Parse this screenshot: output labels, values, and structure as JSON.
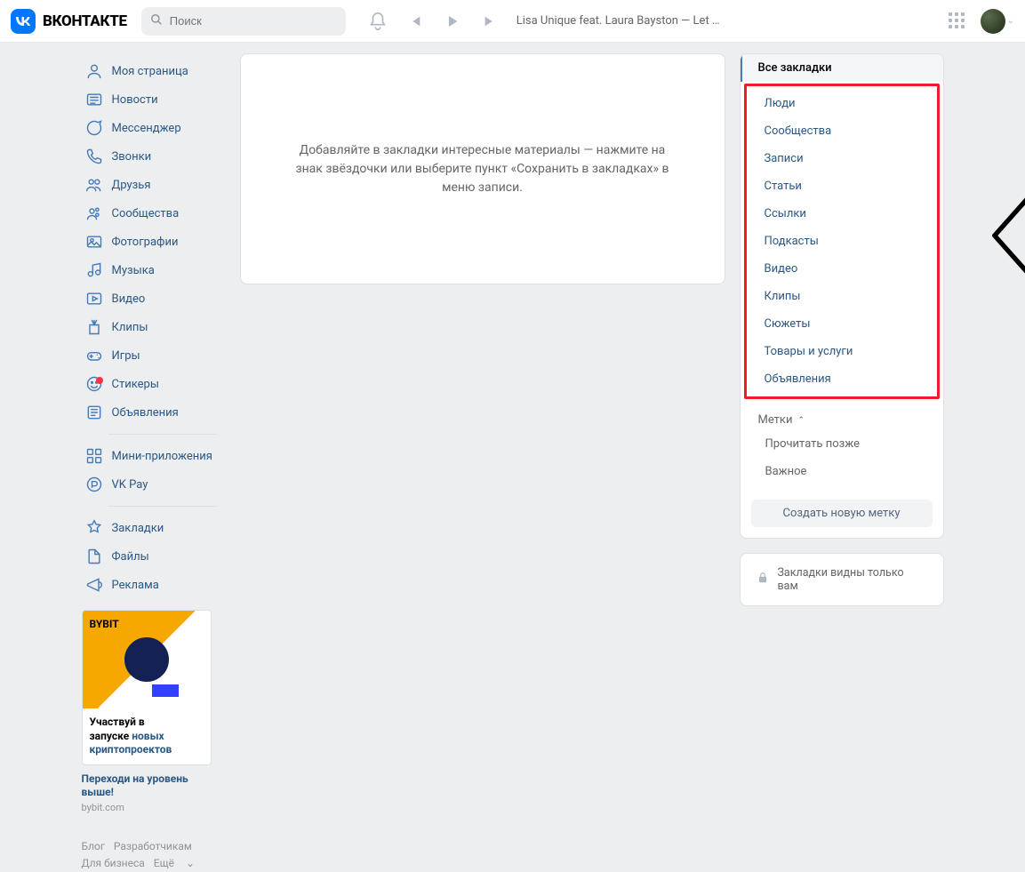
{
  "header": {
    "brand": "ВКОНТАКТЕ",
    "search_placeholder": "Поиск",
    "track": "Lisa Unique feat. Laura Bayston — Let …"
  },
  "nav": {
    "items": [
      {
        "label": "Моя страница",
        "icon": "profile"
      },
      {
        "label": "Новости",
        "icon": "news"
      },
      {
        "label": "Мессенджер",
        "icon": "messenger"
      },
      {
        "label": "Звонки",
        "icon": "calls"
      },
      {
        "label": "Друзья",
        "icon": "friends"
      },
      {
        "label": "Сообщества",
        "icon": "communities"
      },
      {
        "label": "Фотографии",
        "icon": "photos"
      },
      {
        "label": "Музыка",
        "icon": "music"
      },
      {
        "label": "Видео",
        "icon": "video"
      },
      {
        "label": "Клипы",
        "icon": "clips"
      },
      {
        "label": "Игры",
        "icon": "games"
      },
      {
        "label": "Стикеры",
        "icon": "stickers",
        "badge": true
      },
      {
        "label": "Объявления",
        "icon": "ads"
      }
    ],
    "items2": [
      {
        "label": "Мини-приложения",
        "icon": "miniapps"
      },
      {
        "label": "VK Pay",
        "icon": "vkpay"
      }
    ],
    "items3": [
      {
        "label": "Закладки",
        "icon": "bookmarks"
      },
      {
        "label": "Файлы",
        "icon": "files"
      },
      {
        "label": "Реклама",
        "icon": "adverts"
      }
    ]
  },
  "main": {
    "placeholder": "Добавляйте в закладки интересные материалы — нажмите на знак звёздочки или выберите пункт «Сохранить в закладках» в меню записи."
  },
  "side": {
    "all": "Все закладки",
    "cats": [
      "Люди",
      "Сообщества",
      "Записи",
      "Статьи",
      "Ссылки",
      "Подкасты",
      "Видео",
      "Клипы",
      "Сюжеты",
      "Товары и услуги",
      "Объявления"
    ],
    "tags_header": "Метки",
    "tags": [
      "Прочитать позже",
      "Важное"
    ],
    "create_tag": "Создать новую метку",
    "visibility": "Закладки видны только вам"
  },
  "ad": {
    "logo": "BYBIT",
    "line1": "Участвуй в",
    "line2": "запуске",
    "link1": "новых",
    "link2": "криптопроектов",
    "sub1": "Переходи на уровень",
    "sub2": "выше!",
    "domain": "bybit.com"
  },
  "footer": {
    "l1": "Блог",
    "l2": "Разработчикам",
    "l3": "Для бизнеса",
    "l4": "Ещё"
  }
}
